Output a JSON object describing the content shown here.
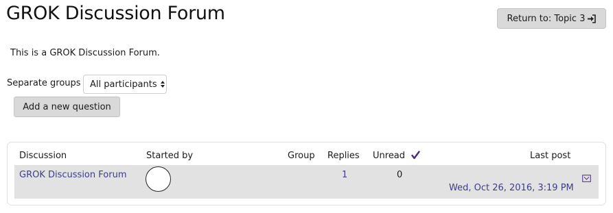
{
  "page": {
    "title": "GROK Discussion Forum",
    "return_button": "Return to: Topic 3",
    "return_icon": "sign-in-icon",
    "intro": "This is a GROK Discussion Forum."
  },
  "groups": {
    "label": "Separate groups",
    "selected": "All participants"
  },
  "actions": {
    "add_question": "Add a new question"
  },
  "table": {
    "headers": {
      "discussion": "Discussion",
      "started_by": "Started by",
      "group": "Group",
      "replies": "Replies",
      "unread": "Unread",
      "last_post": "Last post"
    },
    "unread_icon": "checkmark-icon",
    "rows": [
      {
        "discussion": "GROK Discussion Forum",
        "started_by_avatar": "avatar-circle",
        "group": "",
        "replies": "1",
        "unread": "0",
        "last_post": "Wed, Oct 26, 2016, 3:19 PM",
        "subscribe_icon": "envelope-icon"
      }
    ]
  },
  "colors": {
    "link": "#3d3d8a",
    "button_bg": "#d9d9d9",
    "row_bg": "#e2e2e2",
    "check": "#4a2a7a"
  }
}
